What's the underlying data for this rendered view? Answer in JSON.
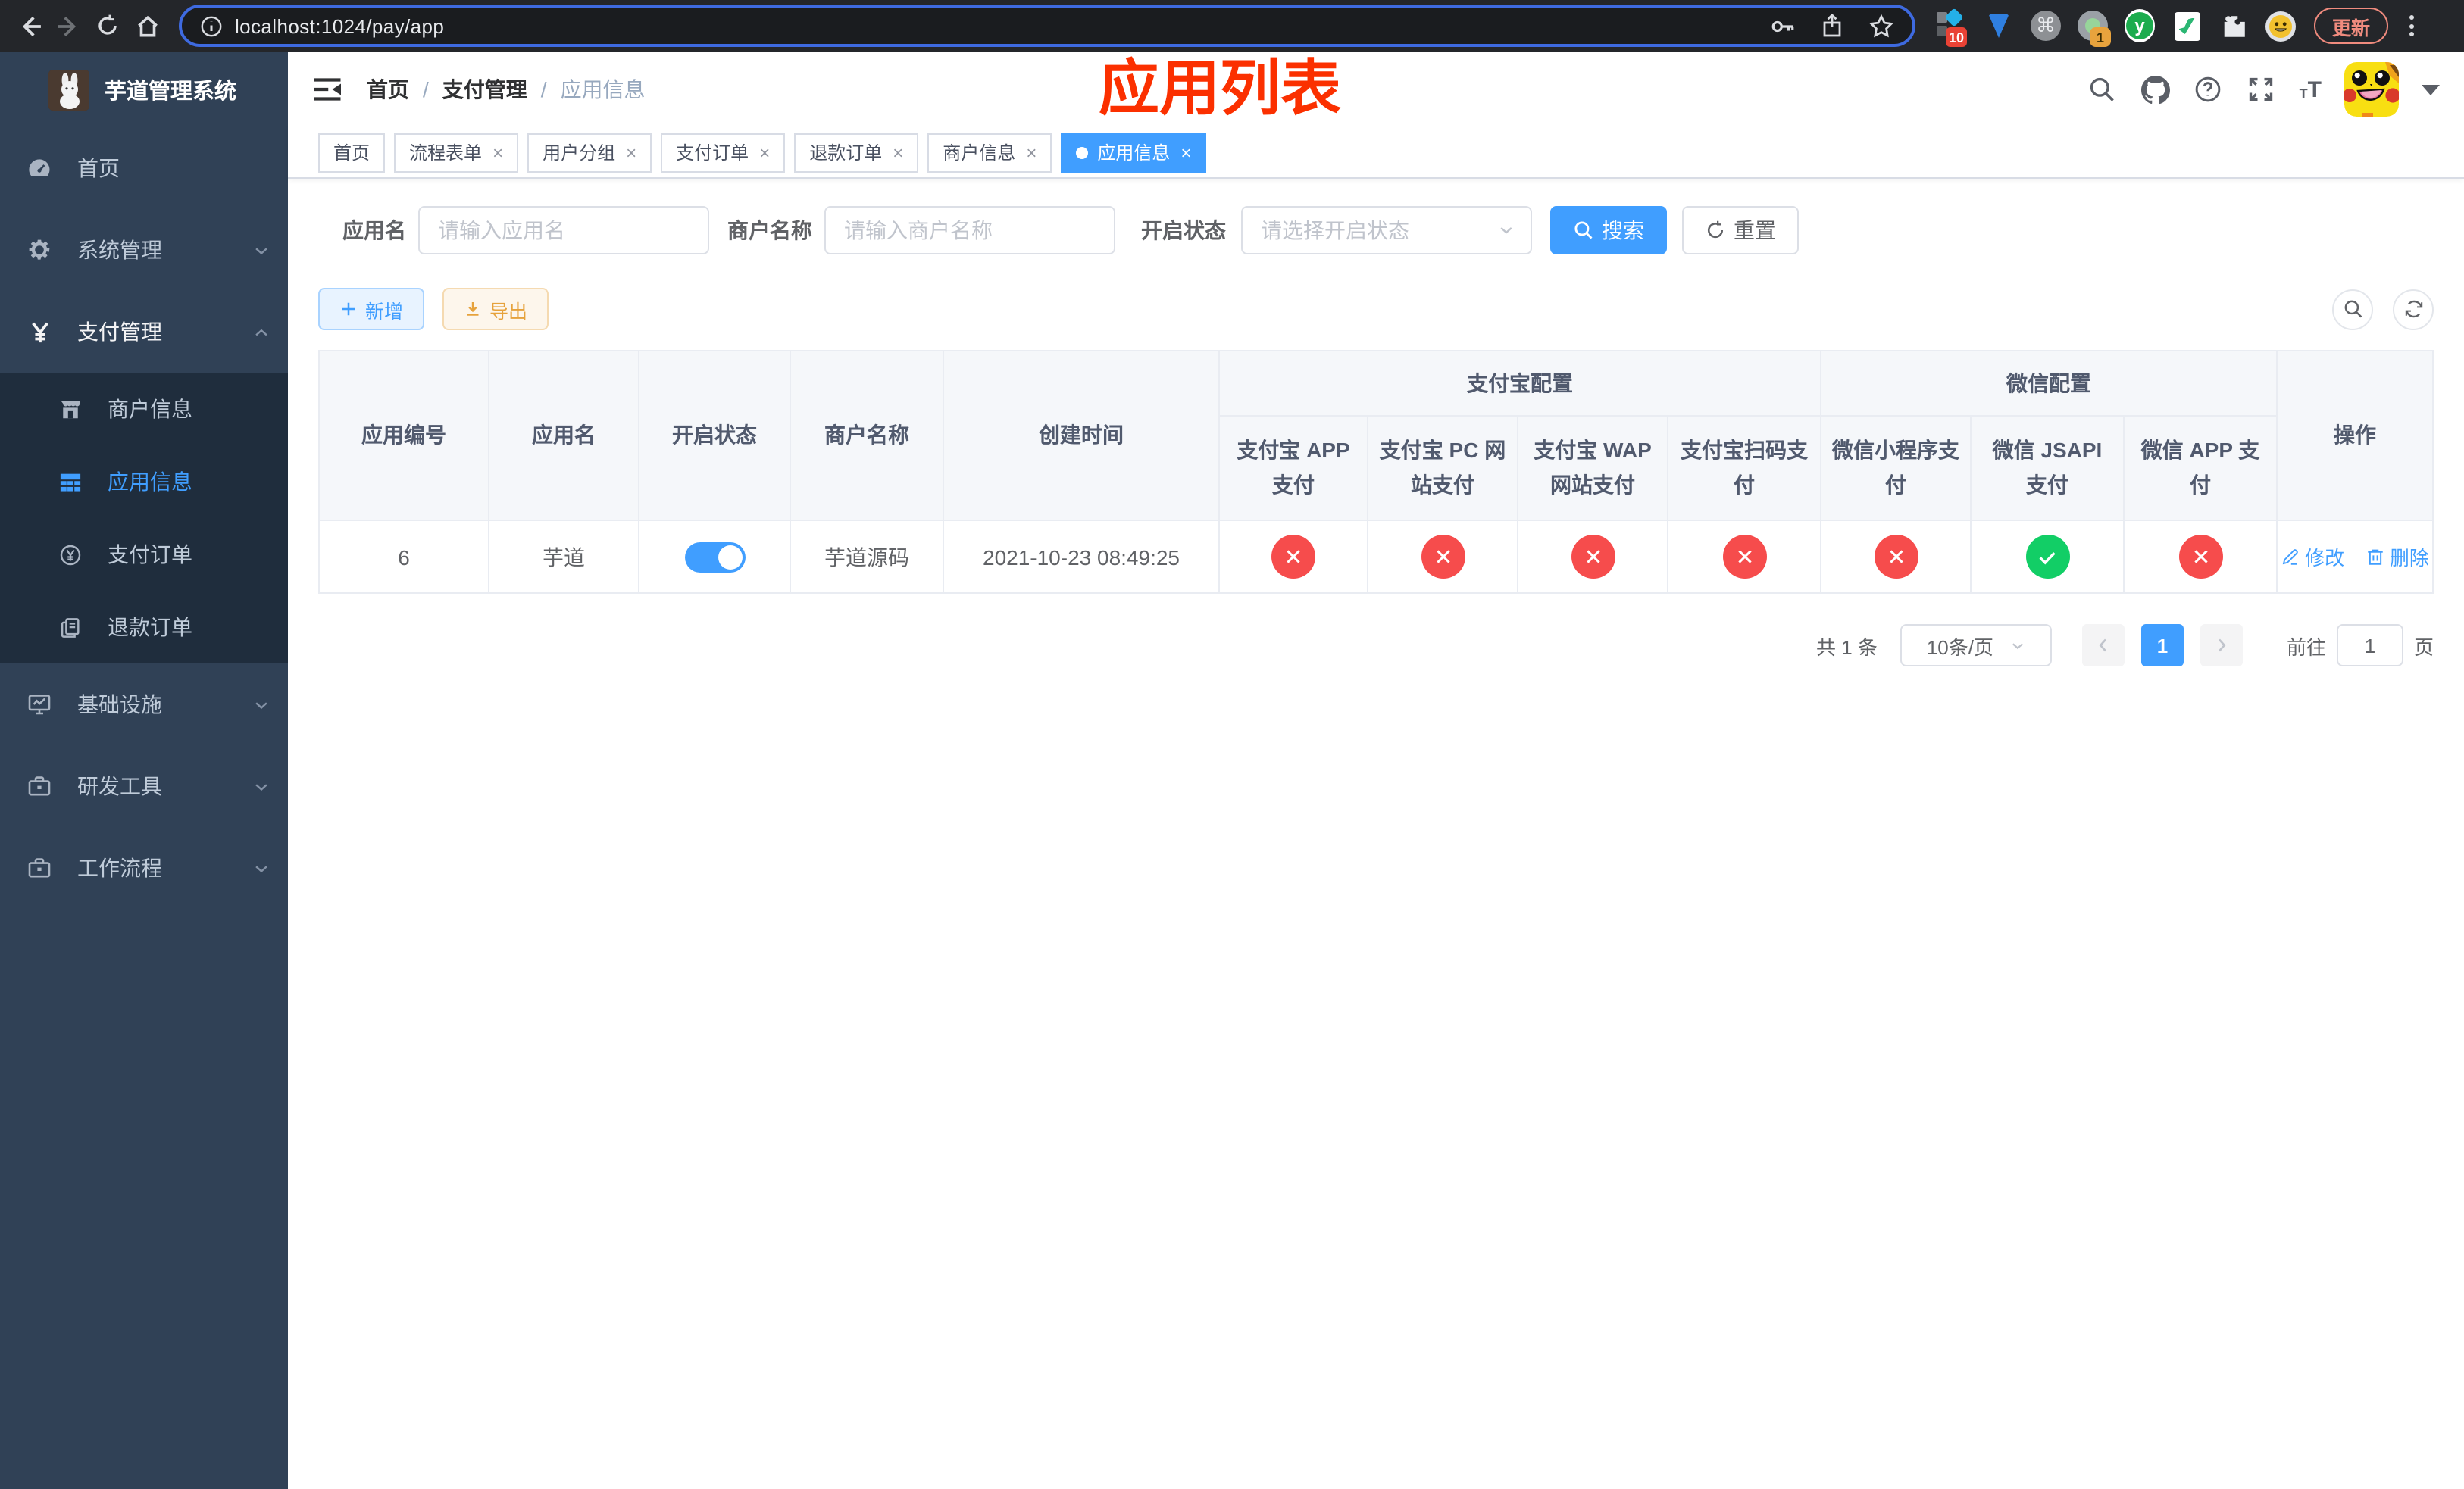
{
  "browser": {
    "url": "localhost:1024/pay/app",
    "update_label": "更新",
    "ext_badge_ten": "10",
    "ext_badge_one": "1",
    "ext_y_label": "y",
    "cmd_glyph": "⌘"
  },
  "header": {
    "breadcrumb": {
      "items": [
        "首页",
        "支付管理",
        "应用信息"
      ],
      "separator": "/"
    },
    "annotation": "应用列表"
  },
  "sidebar": {
    "title": "芋道管理系统",
    "items": [
      {
        "label": "首页"
      },
      {
        "label": "系统管理"
      },
      {
        "label": "支付管理"
      },
      {
        "label": "商户信息"
      },
      {
        "label": "应用信息"
      },
      {
        "label": "支付订单"
      },
      {
        "label": "退款订单"
      },
      {
        "label": "基础设施"
      },
      {
        "label": "研发工具"
      },
      {
        "label": "工作流程"
      }
    ]
  },
  "tags": [
    {
      "label": "首页"
    },
    {
      "label": "流程表单"
    },
    {
      "label": "用户分组"
    },
    {
      "label": "支付订单"
    },
    {
      "label": "退款订单"
    },
    {
      "label": "商户信息"
    },
    {
      "label": "应用信息"
    }
  ],
  "tag_close": "×",
  "filters": {
    "app_name_label": "应用名",
    "app_name_placeholder": "请输入应用名",
    "merchant_label": "商户名称",
    "merchant_placeholder": "请输入商户名称",
    "status_label": "开启状态",
    "status_placeholder": "请选择开启状态",
    "search_label": "搜索",
    "reset_label": "重置"
  },
  "toolbar": {
    "add_label": "新增",
    "export_label": "导出"
  },
  "table": {
    "columns": {
      "app_id": "应用编号",
      "app_name": "应用名",
      "enabled": "开启状态",
      "merchant": "商户名称",
      "created": "创建时间",
      "alipay_group": "支付宝配置",
      "wechat_group": "微信配置",
      "alipay_app": "支付宝 APP 支付",
      "alipay_pc": "支付宝 PC 网站支付",
      "alipay_wap": "支付宝 WAP 网站支付",
      "alipay_qr": "支付宝扫码支付",
      "wx_lite": "微信小程序支付",
      "wx_jsapi": "微信 JSAPI 支付",
      "wx_app": "微信 APP 支付",
      "op": "操作"
    },
    "row": {
      "id": "6",
      "name": "芋道",
      "enabled": true,
      "merchant": "芋道源码",
      "created": "2021-10-23 08:49:25",
      "statuses": [
        false,
        false,
        false,
        false,
        false,
        true,
        false
      ],
      "edit_label": "修改",
      "delete_label": "删除"
    }
  },
  "pagination": {
    "total": "共 1 条",
    "page_size": "10条/页",
    "page": "1",
    "goto_label": "前往",
    "goto_value": "1",
    "page_unit": "页"
  },
  "colors": {
    "primary": "#409eff",
    "success": "#12ce66",
    "danger": "#f64c4c",
    "annotation": "#fb3000"
  }
}
